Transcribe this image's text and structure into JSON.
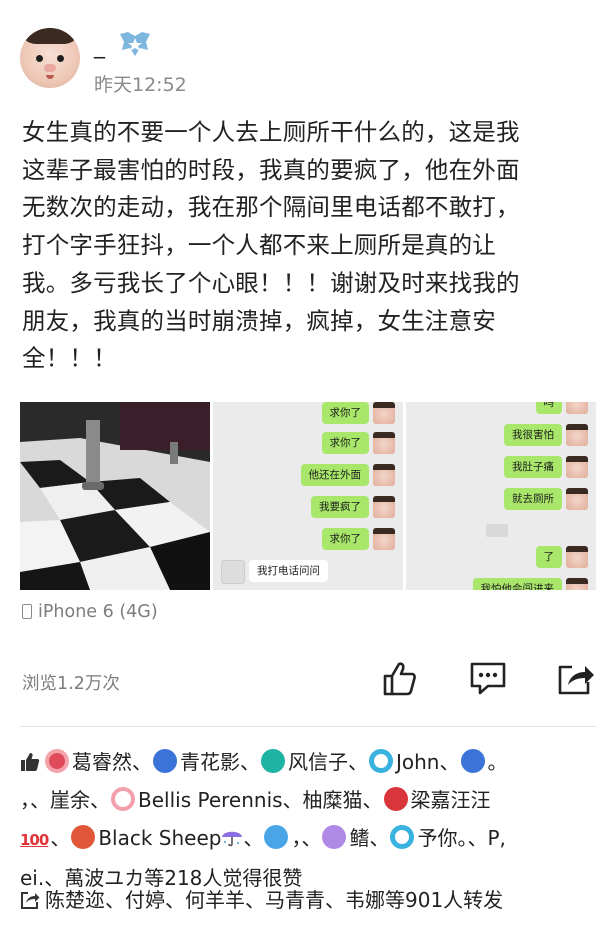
{
  "post": {
    "username": "_",
    "timestamp": "昨天12:52",
    "text_lines": [
      "女生真的不要一个人去上厕所干什么的，这是我",
      "这辈子最害怕的时段，我真的要疯了，他在外面",
      "无数次的走动，我在那个隔间里电话都不敢打，",
      "打个字手狂抖，一个人都不来上厕所是真的让",
      "我。多亏我长了个心眼！！！谢谢及时来找我的",
      "朋友，我真的当时崩溃掉，疯掉，女生注意安",
      "全！！！"
    ],
    "device": "iPhone 6 (4G)",
    "views": "浏览1.2万次"
  },
  "images": {
    "img2_messages": [
      "求你了",
      "求你了",
      "他还在外面",
      "我要疯了",
      "求你了"
    ],
    "img2_left_message": "我打电话问问",
    "img3_messages": [
      "吗",
      "我很害怕",
      "我肚子痛",
      "就去厕所",
      "了",
      "我怕他会闯进来"
    ]
  },
  "likes": {
    "line1": [
      "葛睿然、",
      "青花影、",
      "风信子、",
      "John、",
      "。"
    ],
    "line2_prefix": "，、崖余、",
    "line2": [
      "Bellis Perennis、柚糜猫、",
      "梁嘉汪汪"
    ],
    "line3_hundred": "100",
    "line3": [
      "、",
      "Black Sheep",
      "、",
      "，、",
      "鳍、",
      "予你。、P,"
    ],
    "line4": "ei.、萬波ユカ等218人觉得很赞"
  },
  "reposts": {
    "text": "陈楚迩、付婷、何羊羊、马青青、韦娜等901人转发"
  },
  "colors": {
    "bubble_green": "#a9e76b",
    "meta_gray": "#7d7d7d"
  },
  "icons": [
    "like-icon",
    "comment-icon",
    "share-icon",
    "phone-icon",
    "repost-icon",
    "thumbs-up-icon",
    "verified-badge-icon"
  ]
}
